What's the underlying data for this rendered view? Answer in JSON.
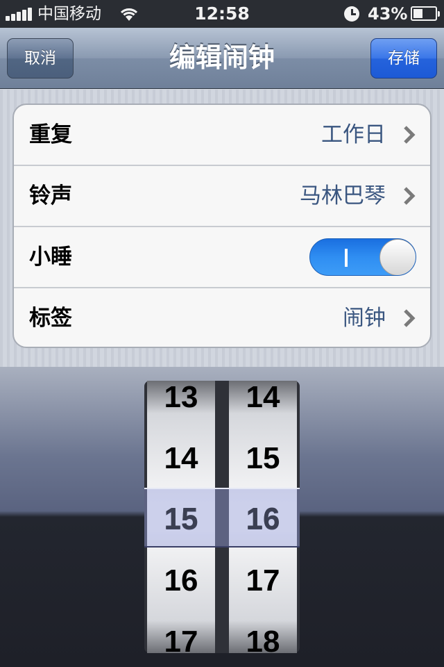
{
  "status_bar": {
    "carrier": "中国移动",
    "time": "12:58",
    "battery_percent_label": "43%",
    "battery_level": 0.43
  },
  "nav": {
    "title": "编辑闹钟",
    "cancel_label": "取消",
    "save_label": "存储"
  },
  "settings": {
    "repeat": {
      "label": "重复",
      "value": "工作日"
    },
    "sound": {
      "label": "铃声",
      "value": "马林巴琴"
    },
    "snooze": {
      "label": "小睡",
      "on": true,
      "toggle_text": "I"
    },
    "label": {
      "label": "标签",
      "value": "闹钟"
    }
  },
  "picker": {
    "hours": [
      "13",
      "14",
      "15",
      "16",
      "17"
    ],
    "minutes": [
      "14",
      "15",
      "16",
      "17",
      "18"
    ],
    "selected_hour": "15",
    "selected_minute": "16"
  },
  "colors": {
    "accent": "#2f8ef2",
    "save_button": "#2563dc",
    "value_text": "#3a5680"
  }
}
